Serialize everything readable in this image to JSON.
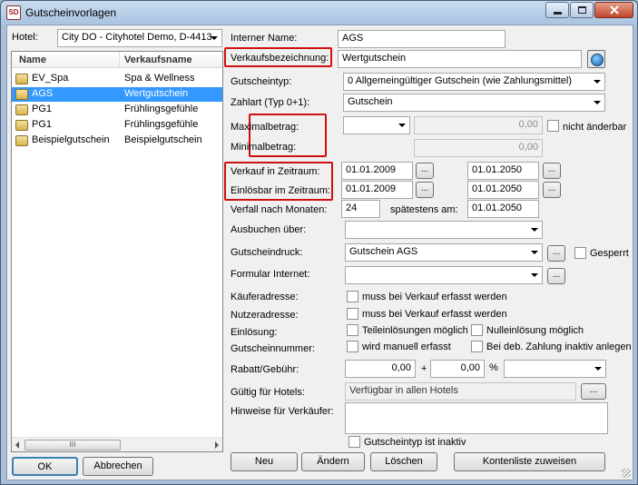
{
  "window": {
    "title": "Gutscheinvorlagen",
    "app_icon_text": "SD"
  },
  "hotel": {
    "label": "Hotel:",
    "value": "City DO - Cityhotel Demo, D-4413"
  },
  "list": {
    "columns": [
      "Name",
      "Verkaufsname"
    ],
    "rows": [
      {
        "name": "EV_Spa",
        "verkaufsname": "Spa & Wellness",
        "selected": false
      },
      {
        "name": "AGS",
        "verkaufsname": "Wertgutschein",
        "selected": true
      },
      {
        "name": "PG1",
        "verkaufsname": "Frühlingsgefühle",
        "selected": false
      },
      {
        "name": "PG1",
        "verkaufsname": "Frühlingsgefühle",
        "selected": false
      },
      {
        "name": "Beispielgutschein",
        "verkaufsname": "Beispielgutschein",
        "selected": false
      }
    ],
    "scroll_thumb": "III"
  },
  "form": {
    "interner_name": {
      "label": "Interner Name:",
      "value": "AGS"
    },
    "verkaufsbezeichnung": {
      "label": "Verkaufsbezeichnung:",
      "value": "Wertgutschein"
    },
    "gutscheintyp": {
      "label": "Gutscheintyp:",
      "value": "0 Allgemeingültiger Gutschein (wie Zahlungsmittel)"
    },
    "zahlart": {
      "label": "Zahlart (Typ 0+1):",
      "value": "Gutschein"
    },
    "maximalbetrag": {
      "label": "Maximalbetrag:",
      "value": "0,00",
      "nicht_aenderbar": "nicht änderbar"
    },
    "minimalbetrag": {
      "label": "Minimalbetrag:",
      "value": "0,00"
    },
    "verkauf": {
      "label": "Verkauf in Zeitraum:",
      "from": "01.01.2009",
      "to": "01.01.2050"
    },
    "einloesbar": {
      "label": "Einlösbar im Zeitraum:",
      "from": "01.01.2009",
      "to": "01.01.2050"
    },
    "verfall": {
      "label": "Verfall nach Monaten:",
      "value": "24",
      "spaetestens_label": "spätestens am:",
      "spaetestens_value": "01.01.2050"
    },
    "ausbuchen": {
      "label": "Ausbuchen über:",
      "value": ""
    },
    "gutscheindruck": {
      "label": "Gutscheindruck:",
      "value": "Gutschein AGS",
      "gesperrt": "Gesperrt"
    },
    "formular_internet": {
      "label": "Formular Internet:",
      "value": ""
    },
    "kaeuferadresse": {
      "label": "Käuferadresse:",
      "checkbox": "muss bei Verkauf erfasst werden"
    },
    "nutzeradresse": {
      "label": "Nutzeradresse:",
      "checkbox": "muss bei Verkauf erfasst werden"
    },
    "einloesung": {
      "label": "Einlösung:",
      "teil": "Teileinlösungen möglich",
      "null": "Nulleinlösung möglich"
    },
    "gutscheinnummer": {
      "label": "Gutscheinnummer:",
      "manuell": "wird manuell erfasst",
      "inaktiv": "Bei deb. Zahlung inaktiv anlegen"
    },
    "rabatt": {
      "label": "Rabatt/Gebühr:",
      "value1": "0,00",
      "plus": "+",
      "value2": "0,00",
      "percent": "%"
    },
    "gueltig": {
      "label": "Gültig für Hotels:",
      "value": "Verfügbar in allen Hotels"
    },
    "hinweise": {
      "label": "Hinweise für Verkäufer:",
      "value": ""
    },
    "inaktiv": "Gutscheintyp ist inaktiv",
    "dots": "..."
  },
  "buttons": {
    "ok": "OK",
    "abbrechen": "Abbrechen",
    "neu": "Neu",
    "aendern": "Ändern",
    "loeschen": "Löschen",
    "kontenliste": "Kontenliste zuweisen"
  },
  "colors": {
    "highlight": "#d01010",
    "selection": "#3399ff"
  }
}
